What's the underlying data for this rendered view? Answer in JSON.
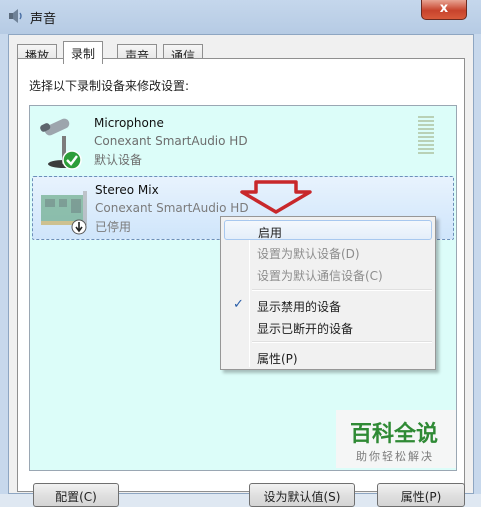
{
  "window": {
    "title": "声音",
    "close_glyph": "x"
  },
  "tabs": [
    {
      "label": "播放"
    },
    {
      "label": "录制",
      "active": true
    },
    {
      "label": "声音"
    },
    {
      "label": "通信"
    }
  ],
  "instruction": "选择以下录制设备来修改设置:",
  "devices": [
    {
      "name": "Microphone",
      "driver": "Conexant SmartAudio HD",
      "status": "默认设备",
      "icon": "microphone-icon",
      "badge": "default-check-badge"
    },
    {
      "name": "Stereo Mix",
      "driver": "Conexant SmartAudio HD",
      "status": "已停用",
      "icon": "sound-card-icon",
      "badge": "disabled-arrow-badge"
    }
  ],
  "context_menu": {
    "items": [
      {
        "label": "启用",
        "state": "hover"
      },
      {
        "label": "设置为默认设备(D)",
        "state": "disabled"
      },
      {
        "label": "设置为默认通信设备(C)",
        "state": "disabled"
      },
      {
        "label": "显示禁用的设备",
        "checked": true
      },
      {
        "label": "显示已断开的设备"
      },
      {
        "label": "属性(P)"
      }
    ]
  },
  "buttons": {
    "configure": "配置(C)",
    "set_default": "设为默认值(S)",
    "properties": "属性(P)"
  },
  "watermark": {
    "main": "百科全说",
    "sub": "助你轻松解决"
  },
  "colors": {
    "list_background": "#dcfdf9",
    "arrow_red": "#c8282b",
    "check_green": "#2e9e3a",
    "watermark_green": "#2f8a35"
  }
}
